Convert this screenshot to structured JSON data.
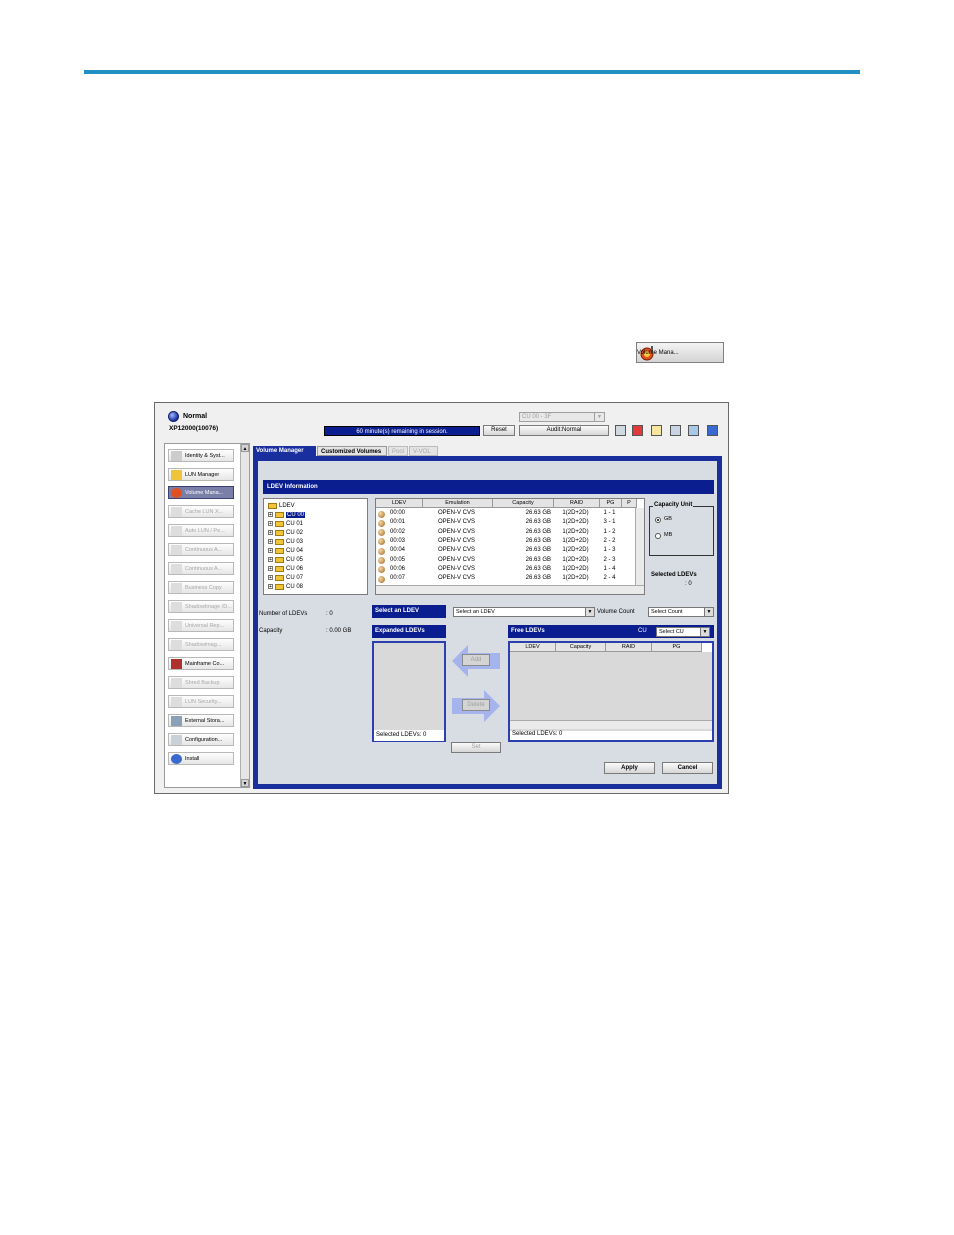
{
  "inline_button": {
    "label": "Volume Mana..."
  },
  "window": {
    "status": "Normal",
    "model": "XP12000(10076)",
    "cu_select": "CU 00 - 3F",
    "session": "60 minute(s) remaining in session.",
    "reset_label": "Reset",
    "audit_label": "Audit:Normal"
  },
  "sidebar": {
    "items": [
      "Identity & Syst...",
      "LUN Manager",
      "Volume Mana...",
      "Cache LUN X...",
      "Auto LUN / Pe...",
      "Continuous A...",
      "Continuous A...",
      "Business Copy",
      "ShadowImage /D...",
      "Universal Rep...",
      "Shadowimag...",
      "Mainframe Co...",
      "Shred Backup",
      "LUN Security...",
      "External Stora...",
      "Configuration...",
      "Install"
    ]
  },
  "tabs": [
    "Volume Manager",
    "Customized Volumes",
    "Pool",
    "V-VOL"
  ],
  "ldev_info": {
    "title": "LDEV Information",
    "tree_root": "LDEV",
    "tree_items": [
      "CU 00",
      "CU 01",
      "CU 02",
      "CU 03",
      "CU 04",
      "CU 05",
      "CU 06",
      "CU 07",
      "CU 08"
    ],
    "columns": [
      "LDEV",
      "Emulation",
      "Capacity",
      "RAID",
      "PG",
      "P"
    ],
    "rows": [
      [
        "00:00",
        "OPEN-V CVS",
        "26.63 GB",
        "1(2D+2D)",
        "1 - 1"
      ],
      [
        "00:01",
        "OPEN-V CVS",
        "26.63 GB",
        "1(2D+2D)",
        "3 - 1"
      ],
      [
        "00:02",
        "OPEN-V CVS",
        "26.63 GB",
        "1(2D+2D)",
        "1 - 2"
      ],
      [
        "00:03",
        "OPEN-V CVS",
        "26.63 GB",
        "1(2D+2D)",
        "2 - 2"
      ],
      [
        "00:04",
        "OPEN-V CVS",
        "26.63 GB",
        "1(2D+2D)",
        "1 - 3"
      ],
      [
        "00:05",
        "OPEN-V CVS",
        "26.63 GB",
        "1(2D+2D)",
        "2 - 3"
      ],
      [
        "00:06",
        "OPEN-V CVS",
        "26.63 GB",
        "1(2D+2D)",
        "1 - 4"
      ],
      [
        "00:07",
        "OPEN-V CVS",
        "26.63 GB",
        "1(2D+2D)",
        "2 - 4"
      ]
    ],
    "capacity_unit": {
      "legend": "Capacity Unit",
      "gb": "GB",
      "mb": "MB",
      "selected": "GB"
    },
    "selected_ldevs_label": "Selected LDEVs",
    "selected_ldevs_value": ": 0"
  },
  "summary": {
    "num_ldevs_label": "Number of LDEVs",
    "num_ldevs_value": ": 0",
    "capacity_label": "Capacity",
    "capacity_value": ": 0.00 GB"
  },
  "select_ldev": {
    "label": "Select an LDEV",
    "combo": "Select an LDEV",
    "volume_count_label": "Volume Count",
    "volume_count_combo": "Select Count"
  },
  "expanded": {
    "label": "Expanded LDEVs",
    "selected": "Selected LDEVs:  0"
  },
  "free": {
    "label": "Free LDEVs",
    "cu_label": "CU",
    "cu_combo": "Select CU",
    "columns": [
      "LDEV",
      "Capacity",
      "RAID",
      "PG"
    ],
    "selected": "Selected LDEVs:  0"
  },
  "buttons": {
    "add": "Add",
    "delete": "Delete",
    "set": "Set",
    "apply": "Apply",
    "cancel": "Cancel"
  }
}
